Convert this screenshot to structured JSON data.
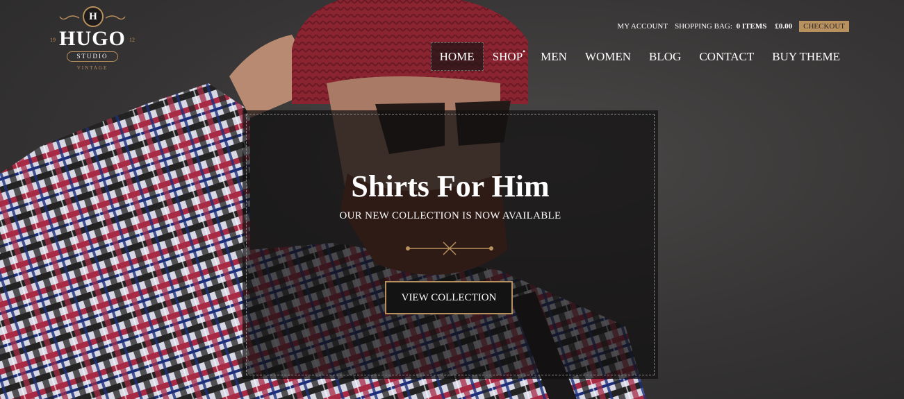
{
  "logo": {
    "letter": "H",
    "name": "HUGO",
    "year_left": "19",
    "year_right": "12",
    "studio": "STUDIO",
    "vintage": "VINTAGE"
  },
  "topbar": {
    "my_account": "MY ACCOUNT",
    "shopping_bag_label": "SHOPPING BAG:",
    "shopping_bag_items": "0 ITEMS",
    "amount": "£0.00",
    "checkout": "CHECKOUT"
  },
  "nav": {
    "items": [
      {
        "label": "HOME"
      },
      {
        "label": "SHOP"
      },
      {
        "label": "MEN"
      },
      {
        "label": "WOMEN"
      },
      {
        "label": "BLOG"
      },
      {
        "label": "CONTACT"
      },
      {
        "label": "BUY THEME"
      }
    ],
    "active": "HOME"
  },
  "hero": {
    "title": "Shirts For Him",
    "subtitle": "OUR NEW COLLECTION IS NOW AVAILABLE",
    "button": "VIEW COLLECTION"
  },
  "colors": {
    "accent": "#b9915e",
    "overlay": "#100f0f"
  }
}
